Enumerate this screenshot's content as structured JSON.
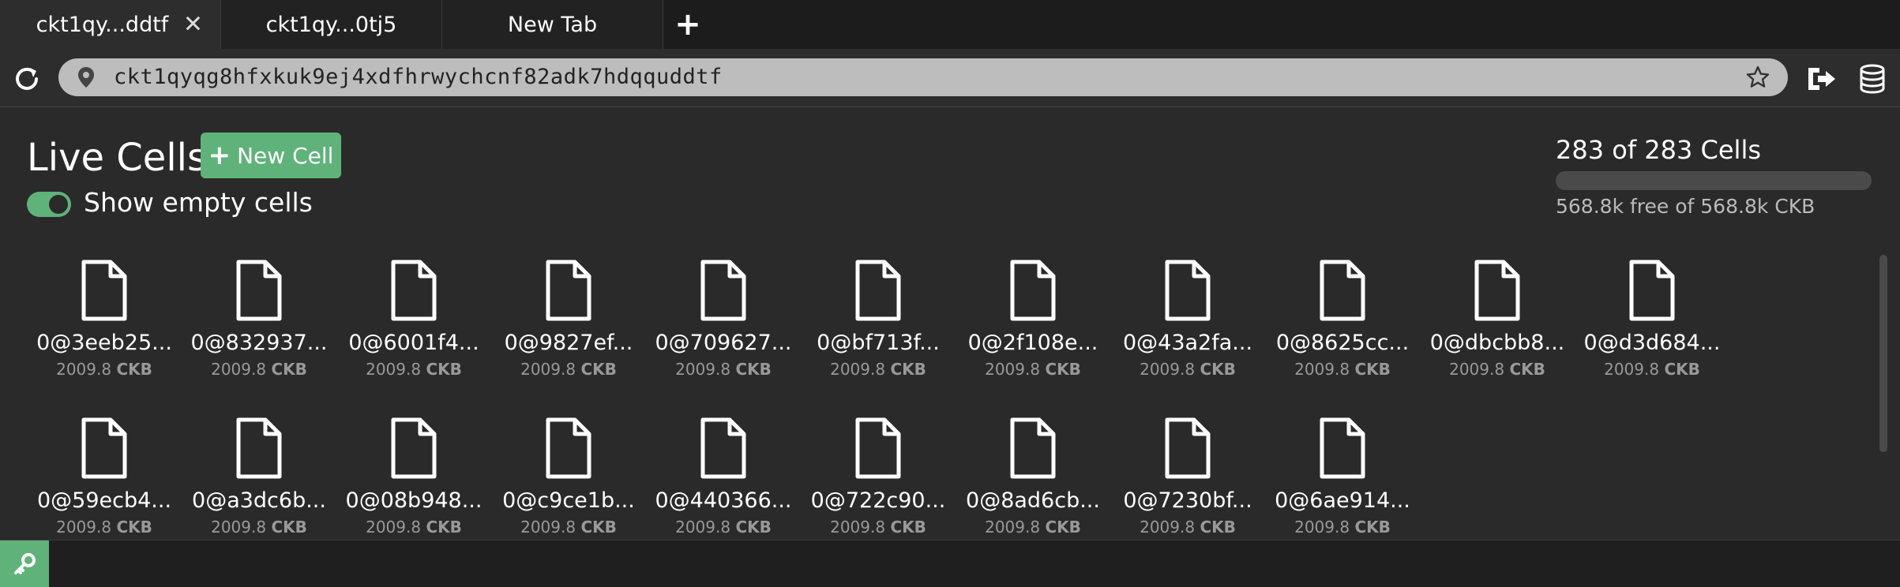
{
  "tabs": [
    {
      "label": "ckt1qy...ddtf",
      "active": true,
      "has_close": true
    },
    {
      "label": "ckt1qy...0tj5",
      "active": false,
      "has_close": false
    },
    {
      "label": "New Tab",
      "active": false,
      "has_close": false
    }
  ],
  "new_tab_label": "+",
  "close_label": "✕",
  "address": {
    "url": "ckt1qyqg8hfxkuk9ej4xdfhrwychcnf82adk7hdqquddtf"
  },
  "page": {
    "title": "Live Cells",
    "new_cell_label": "New Cell",
    "toggle_label": "Show empty cells",
    "toggle_on": true,
    "count_text": "283 of 283 Cells",
    "free_text": "568.8k free of 568.8k CKB",
    "capacity_used_fraction": 0
  },
  "cell_unit": "CKB",
  "cells": [
    {
      "name": "0@3eeb25...",
      "amount": "2009.8"
    },
    {
      "name": "0@832937...",
      "amount": "2009.8"
    },
    {
      "name": "0@6001f4...",
      "amount": "2009.8"
    },
    {
      "name": "0@9827ef...",
      "amount": "2009.8"
    },
    {
      "name": "0@709627...",
      "amount": "2009.8"
    },
    {
      "name": "0@bf713f...",
      "amount": "2009.8"
    },
    {
      "name": "0@2f108e...",
      "amount": "2009.8"
    },
    {
      "name": "0@43a2fa...",
      "amount": "2009.8"
    },
    {
      "name": "0@8625cc...",
      "amount": "2009.8"
    },
    {
      "name": "0@dbcbb8...",
      "amount": "2009.8"
    },
    {
      "name": "0@d3d684...",
      "amount": "2009.8"
    },
    {
      "name": "0@59ecb4...",
      "amount": "2009.8"
    },
    {
      "name": "0@a3dc6b...",
      "amount": "2009.8"
    },
    {
      "name": "0@08b948...",
      "amount": "2009.8"
    },
    {
      "name": "0@c9ce1b...",
      "amount": "2009.8"
    },
    {
      "name": "0@440366...",
      "amount": "2009.8"
    },
    {
      "name": "0@722c90...",
      "amount": "2009.8"
    },
    {
      "name": "0@8ad6cb...",
      "amount": "2009.8"
    },
    {
      "name": "0@7230bf...",
      "amount": "2009.8"
    },
    {
      "name": "0@6ae914...",
      "amount": "2009.8"
    }
  ],
  "icons": {
    "reload": "reload-icon",
    "location": "location-pin-icon",
    "star": "star-icon",
    "logout": "logout-icon",
    "database": "database-icon",
    "file": "file-icon",
    "key": "key-icon"
  },
  "colors": {
    "accent": "#5fb27a",
    "background": "#2a2a2a",
    "tabbar": "#1c1c1c",
    "url_box": "#bdbdbd"
  }
}
